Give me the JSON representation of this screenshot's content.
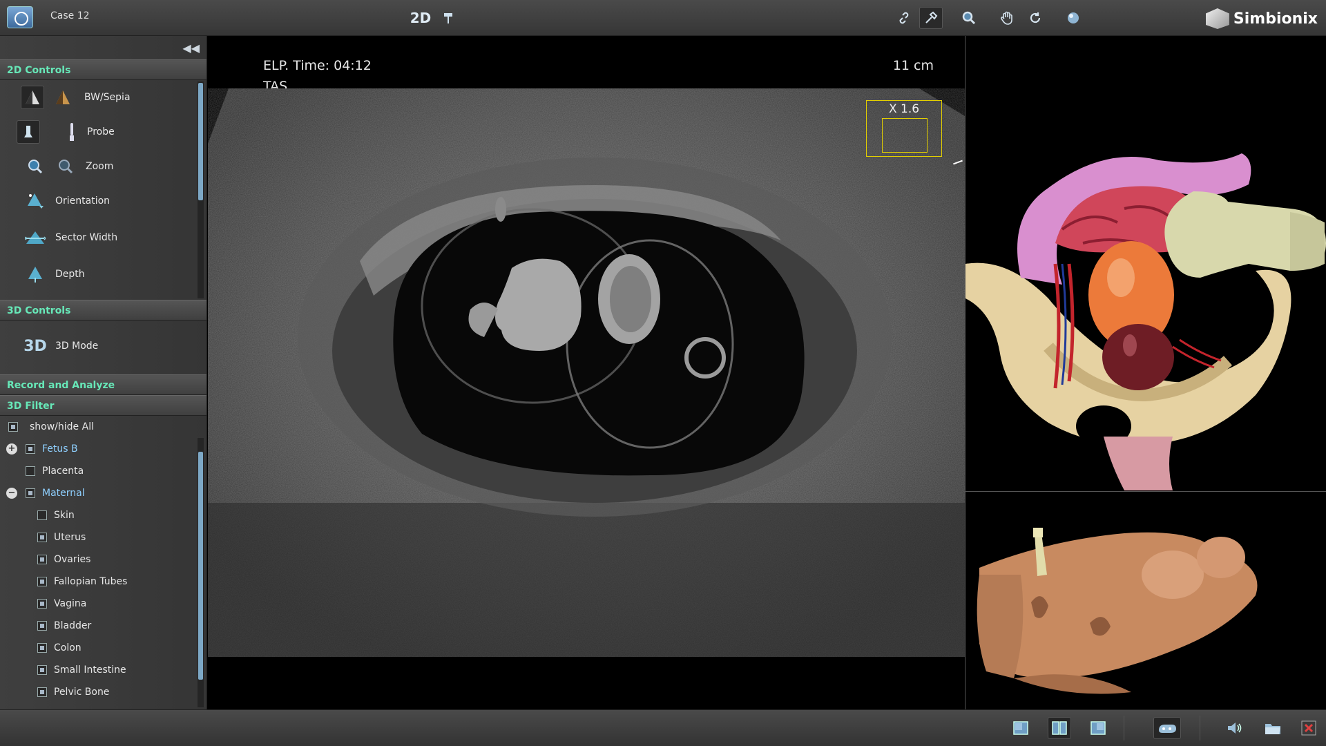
{
  "header": {
    "case_title": "Case 12",
    "mode_label": "2D",
    "brand": "Simbionix",
    "tools": [
      "link-icon",
      "probe-link-icon",
      "zoom-icon",
      "pan-hand-icon",
      "rotate-icon",
      "sphere-icon"
    ]
  },
  "sidebar": {
    "sections": {
      "controls_2d": "2D Controls",
      "controls_3d": "3D Controls",
      "record": "Record and Analyze",
      "filter": "3D Filter"
    },
    "controls_2d": [
      {
        "label": "BW/Sepia"
      },
      {
        "label": "Probe"
      },
      {
        "label": "Zoom"
      },
      {
        "label": "Orientation"
      },
      {
        "label": "Sector Width"
      },
      {
        "label": "Depth"
      }
    ],
    "controls_3d": [
      {
        "label": "3D Mode",
        "icon_text": "3D"
      }
    ],
    "filter": {
      "show_all": "show/hide All",
      "items": [
        {
          "label": "Fetus B",
          "level": 0,
          "expander": "+",
          "checked": true,
          "link": true
        },
        {
          "label": "Placenta",
          "level": 0,
          "expander": "",
          "checked": false,
          "link": false
        },
        {
          "label": "Maternal",
          "level": 0,
          "expander": "−",
          "checked": true,
          "link": true
        },
        {
          "label": "Skin",
          "level": 1,
          "expander": "",
          "checked": false,
          "link": false
        },
        {
          "label": "Uterus",
          "level": 1,
          "expander": "",
          "checked": true,
          "link": false
        },
        {
          "label": "Ovaries",
          "level": 1,
          "expander": "",
          "checked": true,
          "link": false
        },
        {
          "label": "Fallopian Tubes",
          "level": 1,
          "expander": "",
          "checked": true,
          "link": false
        },
        {
          "label": "Vagina",
          "level": 1,
          "expander": "",
          "checked": true,
          "link": false
        },
        {
          "label": "Bladder",
          "level": 1,
          "expander": "",
          "checked": true,
          "link": false
        },
        {
          "label": "Colon",
          "level": 1,
          "expander": "",
          "checked": true,
          "link": false
        },
        {
          "label": "Small Intestine",
          "level": 1,
          "expander": "",
          "checked": true,
          "link": false
        },
        {
          "label": "Pelvic Bone",
          "level": 1,
          "expander": "",
          "checked": true,
          "link": false
        }
      ]
    }
  },
  "ultrasound": {
    "elapsed": "ELP. Time: 04:12",
    "mode": "TAS",
    "depth": "11 cm",
    "zoom": "X 1.6"
  },
  "colors": {
    "accent_green": "#67e8b8",
    "link_blue": "#8fd0ff",
    "zoom_yellow": "#e4d000"
  },
  "footer": {
    "buttons": [
      "single-view-icon",
      "dual-view-icon",
      "side-view-icon",
      "scanner-icon",
      "sound-icon",
      "folder-icon",
      "close-icon"
    ]
  }
}
